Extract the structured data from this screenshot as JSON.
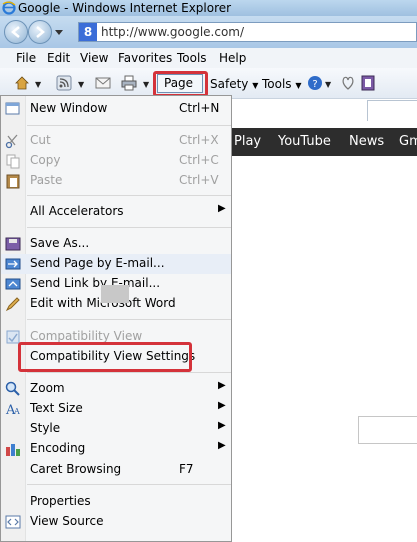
{
  "window": {
    "title": "Google - Windows Internet Explorer"
  },
  "address": {
    "url": "http://www.google.com/"
  },
  "menubar": {
    "items": [
      "File",
      "Edit",
      "View",
      "Favorites",
      "Tools",
      "Help"
    ]
  },
  "commandbar": {
    "page": "Page",
    "safety": "Safety",
    "tools": "Tools"
  },
  "google_bar": {
    "items": [
      "Play",
      "YouTube",
      "News",
      "Gm"
    ]
  },
  "page_menu": {
    "new_window": {
      "label": "New Window",
      "shortcut": "Ctrl+N"
    },
    "cut": {
      "label": "Cut",
      "shortcut": "Ctrl+X"
    },
    "copy": {
      "label": "Copy",
      "shortcut": "Ctrl+C"
    },
    "paste": {
      "label": "Paste",
      "shortcut": "Ctrl+V"
    },
    "all_accelerators": {
      "label": "All Accelerators"
    },
    "save_as": {
      "label": "Save As..."
    },
    "send_page": {
      "label": "Send Page by E-mail..."
    },
    "send_link": {
      "label": "Send Link by E-mail..."
    },
    "edit_word": {
      "label": "Edit with Microsoft Word"
    },
    "compat_view": {
      "label": "Compatibility View"
    },
    "compat_settings": {
      "label": "Compatibility View Settings"
    },
    "zoom": {
      "label": "Zoom"
    },
    "text_size": {
      "label": "Text Size"
    },
    "style": {
      "label": "Style"
    },
    "encoding": {
      "label": "Encoding"
    },
    "caret": {
      "label": "Caret Browsing",
      "shortcut": "F7"
    },
    "properties": {
      "label": "Properties"
    },
    "view_source": {
      "label": "View Source"
    }
  },
  "colors": {
    "highlight_box": "#d4323a",
    "google_bar": "#2d2d2d"
  }
}
